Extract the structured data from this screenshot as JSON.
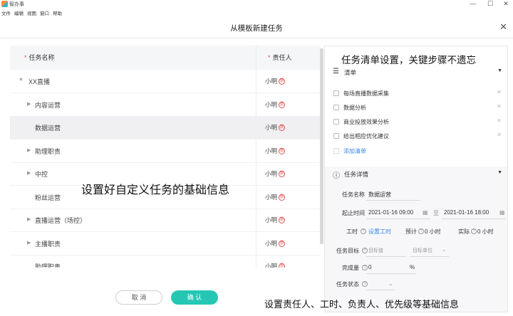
{
  "app": {
    "name": "智办事"
  },
  "window": {
    "minimize": "—",
    "maximize": "☐",
    "close": "✕"
  },
  "menu": [
    "文件",
    "编辑",
    "视图",
    "窗口",
    "帮助"
  ],
  "dialog": {
    "title": "从模板新建任务",
    "close": "✕"
  },
  "table": {
    "col_name": "任务名称",
    "col_owner": "责任人",
    "owner_badge": "禁",
    "rows": [
      {
        "label": "XX直播",
        "owner": "小明",
        "expander": "expanded",
        "indent": 0,
        "selected": false
      },
      {
        "label": "内容运营",
        "owner": "小明",
        "expander": "collapsed",
        "indent": 1,
        "selected": false
      },
      {
        "label": "数据运营",
        "owner": "小明",
        "expander": "none",
        "indent": 1,
        "selected": true
      },
      {
        "label": "助理职责",
        "owner": "小明",
        "expander": "collapsed",
        "indent": 1,
        "selected": false
      },
      {
        "label": "中控",
        "owner": "小明",
        "expander": "collapsed",
        "indent": 1,
        "selected": false
      },
      {
        "label": "粉丝运营",
        "owner": "小明",
        "expander": "none",
        "indent": 1,
        "selected": false
      },
      {
        "label": "直播运营（场控）",
        "owner": "小明",
        "expander": "collapsed",
        "indent": 1,
        "selected": false
      },
      {
        "label": "主播职责",
        "owner": "小明",
        "expander": "collapsed",
        "indent": 1,
        "selected": false
      },
      {
        "label": "助理职责",
        "owner": "小明",
        "expander": "none",
        "indent": 1,
        "selected": false
      }
    ]
  },
  "footer": {
    "cancel": "取 消",
    "confirm": "确 认"
  },
  "panel": {
    "checklist": {
      "title": "清单",
      "items": [
        "每场直播数据采集",
        "数据分析",
        "商业投放效果分析",
        "给出相应优化建议"
      ],
      "add": "添加清单"
    },
    "details": {
      "title": "任务详情",
      "name_label": "任务名称",
      "name_value": "数据运营",
      "time_label": "起止时间",
      "start": "2021-01-16 09:00",
      "end": "2021-01-16 18:00",
      "workhours_label": "工时",
      "workhours_action": "设置工时",
      "estimated_label": "预计",
      "estimated_value": "0 小时",
      "actual_label": "实际",
      "actual_value": "0 小时",
      "goal_label": "任务目标",
      "goal_placeholder": "目标值",
      "goal_unit_placeholder": "目标单位",
      "done_label": "完成量",
      "done_value": "0",
      "done_unit": "%",
      "status_label": "任务状态"
    }
  },
  "callouts": {
    "checklist_tip": "任务清单设置，关键步骤不遗忘",
    "basic_info_tip": "设置好自定义任务的基础信息",
    "owner_tip": "设置责任人、工时、负责人、优先级等基础信息"
  },
  "colors": {
    "accent": "#25c7b4",
    "link": "#3a86e8",
    "required": "#f05454"
  }
}
